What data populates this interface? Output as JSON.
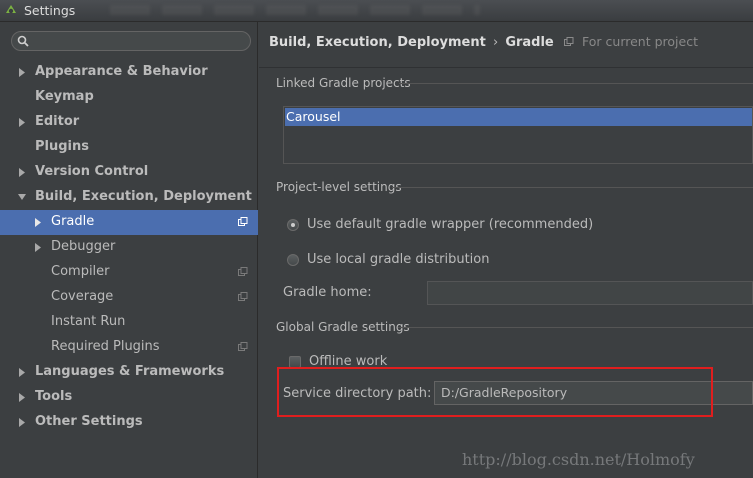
{
  "window": {
    "title": "Settings"
  },
  "search": {
    "value": "",
    "placeholder": ""
  },
  "sidebar": {
    "items": [
      {
        "label": "Appearance & Behavior",
        "arrow": "right"
      },
      {
        "label": "Keymap"
      },
      {
        "label": "Editor",
        "arrow": "right"
      },
      {
        "label": "Plugins"
      },
      {
        "label": "Version Control",
        "arrow": "right"
      },
      {
        "label": "Build, Execution, Deployment",
        "arrow": "down"
      },
      {
        "label": "Gradle",
        "arrow": "right",
        "selected": true,
        "project_icon": true
      },
      {
        "label": "Debugger",
        "arrow": "right"
      },
      {
        "label": "Compiler",
        "project_icon": true
      },
      {
        "label": "Coverage",
        "project_icon": true
      },
      {
        "label": "Instant Run"
      },
      {
        "label": "Required Plugins",
        "project_icon": true
      },
      {
        "label": "Languages & Frameworks",
        "arrow": "right"
      },
      {
        "label": "Tools",
        "arrow": "right"
      },
      {
        "label": "Other Settings",
        "arrow": "right"
      }
    ]
  },
  "breadcrumb": {
    "section": "Build, Execution, Deployment",
    "separator": "›",
    "page": "Gradle",
    "scope": "For current project"
  },
  "linked_projects": {
    "title": "Linked Gradle projects",
    "items": [
      "Carousel"
    ]
  },
  "project_level": {
    "title": "Project-level settings",
    "option_wrapper": "Use default gradle wrapper (recommended)",
    "option_local": "Use local gradle distribution",
    "selected_option": "wrapper",
    "gradle_home_label": "Gradle home:",
    "gradle_home_value": ""
  },
  "global": {
    "title": "Global Gradle settings",
    "offline_label": "Offline work",
    "offline_checked": false,
    "service_dir_label": "Service directory path:",
    "service_dir_value": "D:/GradleRepository"
  },
  "watermark": "http://blog.csdn.net/Holmofy",
  "colors": {
    "background": "#3c3f41",
    "selection": "#4b6eaf",
    "text": "#bbbbbb",
    "highlight": "#e01e1e"
  }
}
